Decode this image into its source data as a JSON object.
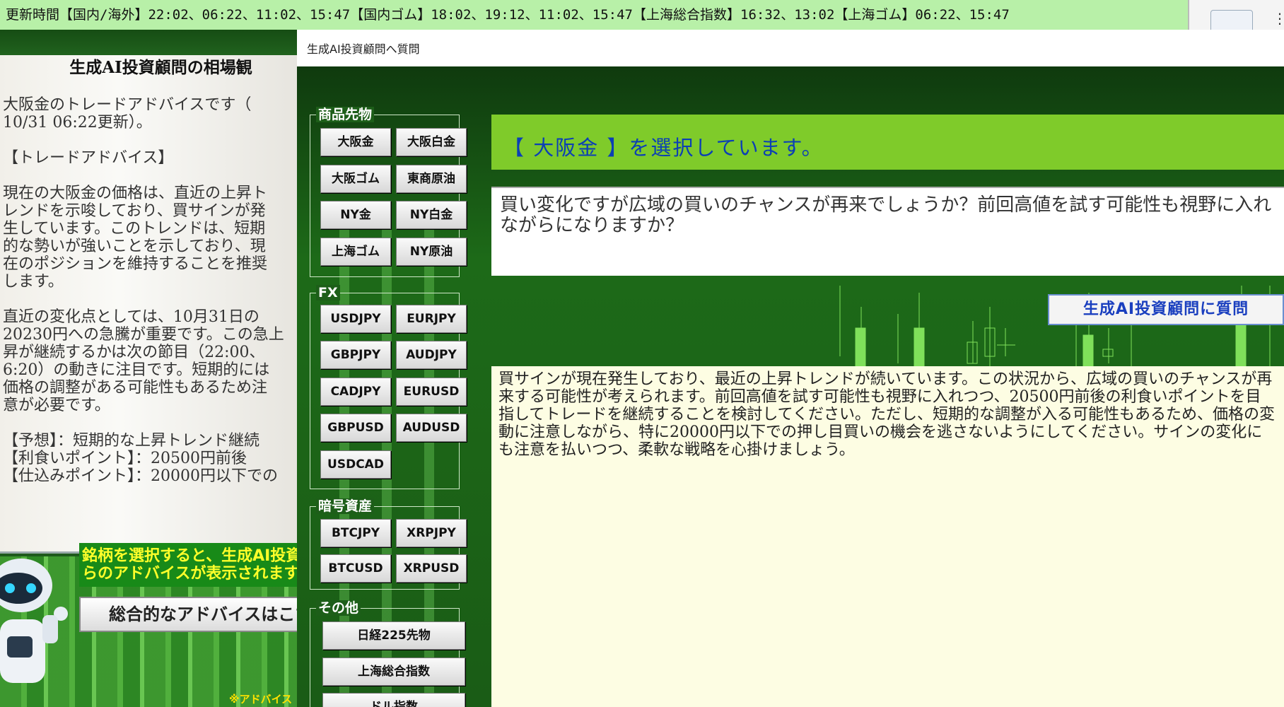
{
  "ticker": {
    "text": "更新時間【国内/海外】22:02、06:22、11:02、15:47【国内ゴム】18:02、19:12、11:02、15:47【上海総合指数】16:32、13:02【上海ゴム】06:22、15:47"
  },
  "left_panel": {
    "title": "生成AI投資顧問の相場観",
    "body": "大阪金のトレードアドバイスです（\n10/31 06:22更新）。\n\n【トレードアドバイス】\n\n現在の大阪金の価格は、直近の上昇ト\nレンドを示唆しており、買サインが発\n生しています。このトレンドは、短期\n的な勢いが強いことを示しており、現\n在のポジションを維持することを推奨\nします。\n\n直近の変化点としては、10月31日の\n20230円への急騰が重要です。この急上\n昇が継続するかは次の節目（22:00、\n6:20）の動きに注目です。短期的には\n価格の調整がある可能性もあるため注\n意が必要です。\n\n【予想】：短期的な上昇トレンド継続\n【利食いポイント】：20500円前後\n【仕込みポイント】：20000円以下での",
    "hint": "銘柄を選択すると、生成AI投資顧問か\nらのアドバイスが表示されます。",
    "overall_button": "総合的なアドバイスはこちら",
    "note": "※アドバイス"
  },
  "dialog": {
    "title": "生成AI投資顧問へ質問",
    "groups": {
      "commodities": {
        "label": "商品先物",
        "buttons": [
          "大阪金",
          "大阪白金",
          "大阪ゴム",
          "東商原油",
          "NY金",
          "NY白金",
          "上海ゴム",
          "NY原油"
        ]
      },
      "fx": {
        "label": "FX",
        "buttons": [
          "USDJPY",
          "EURJPY",
          "GBPJPY",
          "AUDJPY",
          "CADJPY",
          "EURUSD",
          "GBPUSD",
          "AUDUSD",
          "USDCAD"
        ]
      },
      "crypto": {
        "label": "暗号資産",
        "buttons": [
          "BTCJPY",
          "XRPJPY",
          "BTCUSD",
          "XRPUSD"
        ]
      },
      "other": {
        "label": "その他",
        "buttons": [
          "日経225先物",
          "上海総合指数",
          "ドル指数"
        ]
      }
    },
    "selected_text": "【 大阪金 】を選択しています。",
    "question": "買い変化ですが広域の買いのチャンスが再来でしょうか？前回高値を試す可能性も視野に入れながらになりますか？",
    "ask_button": "生成AI投資顧問に質問",
    "answer": "買サインが現在発生しており、最近の上昇トレンドが続いています。この状況から、広域の買いのチャンスが再来する可能性が考えられます。前回高値を試す可能性も視野に入れつつ、20500円前後の利食いポイントを目指してトレードを継続することを検討してください。ただし、短期的な調整が入る可能性もあるため、価格の変動に注意しながら、特に20000円以下での押し目買いの機会を逃さないようにしてください。サインの変化にも注意を払いつつ、柔軟な戦略を心掛けましょう。"
  },
  "colors": {
    "ticker_bg": "#b8f0a8",
    "selected_bar": "#7fcb2a",
    "selected_text": "#0b3fb5",
    "hint_text": "#ffff2a",
    "answer_bg": "#fdfde3"
  }
}
